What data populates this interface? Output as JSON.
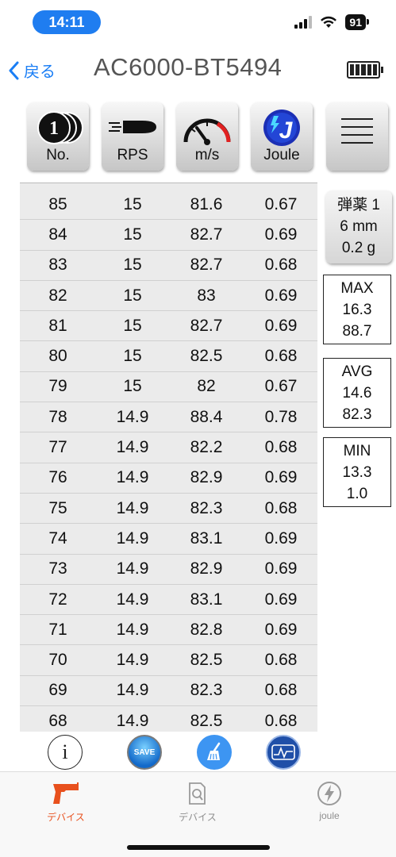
{
  "status_bar": {
    "time": "14:11",
    "battery": "91"
  },
  "nav": {
    "back_label": "戻る",
    "title": "AC6000-BT5494"
  },
  "toolbar": {
    "no_label": "No.",
    "no_icon_glyph": "1",
    "rps_label": "RPS",
    "ms_label": "m/s",
    "joule_label": "Joule",
    "joule_icon_glyph": "J"
  },
  "table": {
    "rows": [
      [
        "85",
        "15",
        "81.6",
        "0.67"
      ],
      [
        "84",
        "15",
        "82.7",
        "0.69"
      ],
      [
        "83",
        "15",
        "82.7",
        "0.68"
      ],
      [
        "82",
        "15",
        "83",
        "0.69"
      ],
      [
        "81",
        "15",
        "82.7",
        "0.69"
      ],
      [
        "80",
        "15",
        "82.5",
        "0.68"
      ],
      [
        "79",
        "15",
        "82",
        "0.67"
      ],
      [
        "78",
        "14.9",
        "88.4",
        "0.78"
      ],
      [
        "77",
        "14.9",
        "82.2",
        "0.68"
      ],
      [
        "76",
        "14.9",
        "82.9",
        "0.69"
      ],
      [
        "75",
        "14.9",
        "82.3",
        "0.68"
      ],
      [
        "74",
        "14.9",
        "83.1",
        "0.69"
      ],
      [
        "73",
        "14.9",
        "82.9",
        "0.69"
      ],
      [
        "72",
        "14.9",
        "83.1",
        "0.69"
      ],
      [
        "71",
        "14.9",
        "82.8",
        "0.69"
      ],
      [
        "70",
        "14.9",
        "82.5",
        "0.68"
      ],
      [
        "69",
        "14.9",
        "82.3",
        "0.68"
      ],
      [
        "68",
        "14.9",
        "82.5",
        "0.68"
      ]
    ]
  },
  "pellet": {
    "line1": "弾薬 1",
    "line2": "6 mm",
    "line3": "0.2 g"
  },
  "stats": {
    "max": {
      "label": "MAX",
      "rps": "16.3",
      "ms": "88.7"
    },
    "avg": {
      "label": "AVG",
      "rps": "14.6",
      "ms": "82.3"
    },
    "min": {
      "label": "MIN",
      "rps": "13.3",
      "ms": "1.0"
    }
  },
  "bottom_tools": {
    "info_glyph": "i",
    "save_label": "SAVE"
  },
  "tabs": [
    {
      "label": "デバイス",
      "icon": "pistol-icon",
      "active": true
    },
    {
      "label": "デバイス",
      "icon": "document-search-icon",
      "active": false
    },
    {
      "label": "joule",
      "icon": "bolt-circle-icon",
      "active": false
    }
  ],
  "colors": {
    "accent": "#1a7ef5",
    "active_tab": "#e8501d",
    "inactive_tab": "#8e8e8e"
  }
}
